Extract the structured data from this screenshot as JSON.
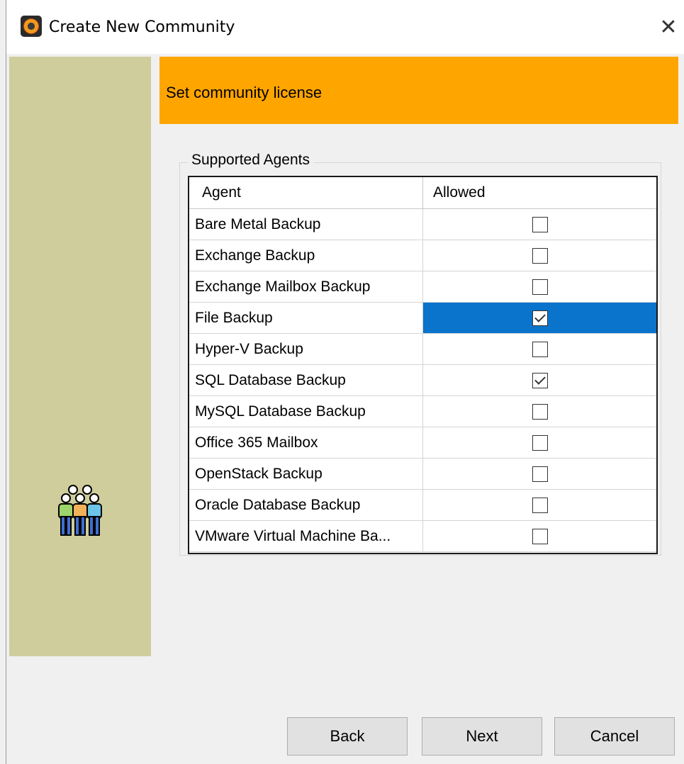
{
  "window": {
    "title": "Create New Community",
    "close_glyph": "✕"
  },
  "header": {
    "text": "Set community license"
  },
  "agents_group": {
    "legend": "Supported Agents",
    "columns": [
      "Agent",
      "Allowed"
    ],
    "rows": [
      {
        "agent": "Bare Metal Backup",
        "allowed": false,
        "selected": false
      },
      {
        "agent": "Exchange Backup",
        "allowed": false,
        "selected": false
      },
      {
        "agent": "Exchange Mailbox Backup",
        "allowed": false,
        "selected": false
      },
      {
        "agent": "File Backup",
        "allowed": true,
        "selected": true
      },
      {
        "agent": "Hyper-V Backup",
        "allowed": false,
        "selected": false
      },
      {
        "agent": "SQL Database Backup",
        "allowed": true,
        "selected": false
      },
      {
        "agent": "MySQL Database Backup",
        "allowed": false,
        "selected": false
      },
      {
        "agent": "Office 365 Mailbox",
        "allowed": false,
        "selected": false
      },
      {
        "agent": "OpenStack Backup",
        "allowed": false,
        "selected": false
      },
      {
        "agent": "Oracle Database Backup",
        "allowed": false,
        "selected": false
      },
      {
        "agent": "VMware Virtual Machine Ba...",
        "allowed": false,
        "selected": false
      }
    ]
  },
  "buttons": {
    "back": "Back",
    "next": "Next",
    "cancel": "Cancel"
  },
  "icons": {
    "app": "app-logo-icon",
    "sidebar": "people-group-icon",
    "close": "close-icon"
  },
  "colors": {
    "header_band": "#ffa500",
    "sidebar": "#cfcd9c",
    "selection": "#0a73cc"
  }
}
